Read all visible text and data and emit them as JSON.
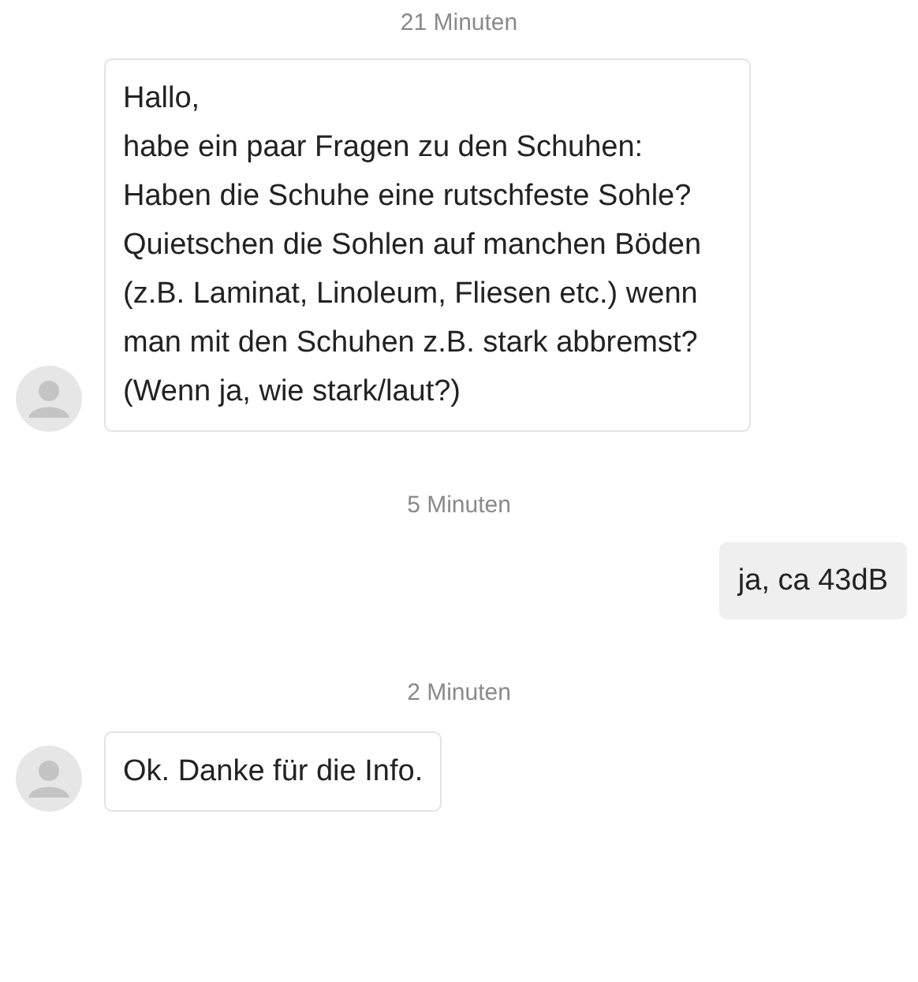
{
  "messages": [
    {
      "kind": "timestamp",
      "text": "21 Minuten"
    },
    {
      "kind": "incoming",
      "text": "Hallo,\nhabe ein paar Fragen zu den Schuhen:\nHaben die Schuhe eine rutschfeste Sohle?\nQuietschen die Sohlen auf manchen Böden (z.B. Laminat, Linoleum, Fliesen etc.) wenn man mit den Schuhen z.B. stark abbremst? (Wenn ja, wie stark/laut?)"
    },
    {
      "kind": "timestamp",
      "text": "5 Minuten"
    },
    {
      "kind": "outgoing",
      "text": "ja, ca 43dB"
    },
    {
      "kind": "timestamp",
      "text": "2 Minuten"
    },
    {
      "kind": "incoming",
      "text": "Ok. Danke für die Info."
    }
  ]
}
